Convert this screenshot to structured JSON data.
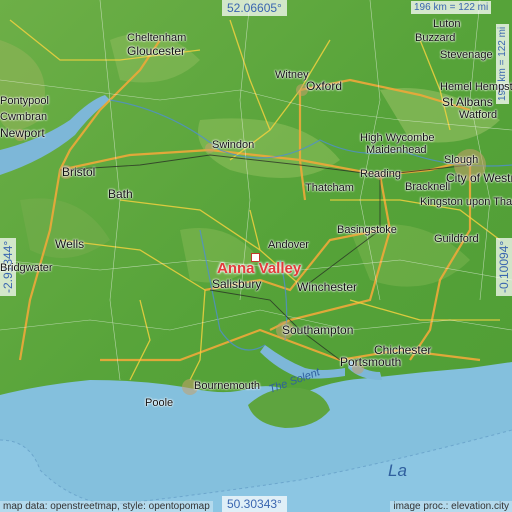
{
  "map": {
    "coords": {
      "north": "52.06605°",
      "south": "50.30343°",
      "west": "-2.91344°",
      "east": "-0.10094°"
    },
    "scale": {
      "horizontal": "196 km = 122 mi",
      "vertical": "196 km = 122 mi"
    },
    "highlight": {
      "name": "Anna Valley"
    },
    "places": [
      {
        "name": "Cheltenham"
      },
      {
        "name": "Gloucester"
      },
      {
        "name": "Luton"
      },
      {
        "name": "Buzzard"
      },
      {
        "name": "Stevenage"
      },
      {
        "name": "Witney"
      },
      {
        "name": "Oxford"
      },
      {
        "name": "Hemel Hempstead"
      },
      {
        "name": "St Albans"
      },
      {
        "name": "Watford"
      },
      {
        "name": "Pontypool"
      },
      {
        "name": "Cwmbran"
      },
      {
        "name": "Newport"
      },
      {
        "name": "Swindon"
      },
      {
        "name": "High Wycombe"
      },
      {
        "name": "Maidenhead"
      },
      {
        "name": "Slough"
      },
      {
        "name": "Reading"
      },
      {
        "name": "Bracknell"
      },
      {
        "name": "City of Westminster"
      },
      {
        "name": "Bristol"
      },
      {
        "name": "Bath"
      },
      {
        "name": "Thatcham"
      },
      {
        "name": "Kingston upon Thames"
      },
      {
        "name": "Basingstoke"
      },
      {
        "name": "Guildford"
      },
      {
        "name": "Wells"
      },
      {
        "name": "Andover"
      },
      {
        "name": "Bridgwater"
      },
      {
        "name": "Salisbury"
      },
      {
        "name": "Winchester"
      },
      {
        "name": "Southampton"
      },
      {
        "name": "Chichester"
      },
      {
        "name": "Portsmouth"
      },
      {
        "name": "Bournemouth"
      },
      {
        "name": "Poole"
      }
    ],
    "water": [
      {
        "name": "The Solent"
      },
      {
        "name": "La"
      }
    ]
  },
  "credits": {
    "left": "map data: openstreetmap, style: opentopomap",
    "right": "image proc.: elevation.city"
  }
}
